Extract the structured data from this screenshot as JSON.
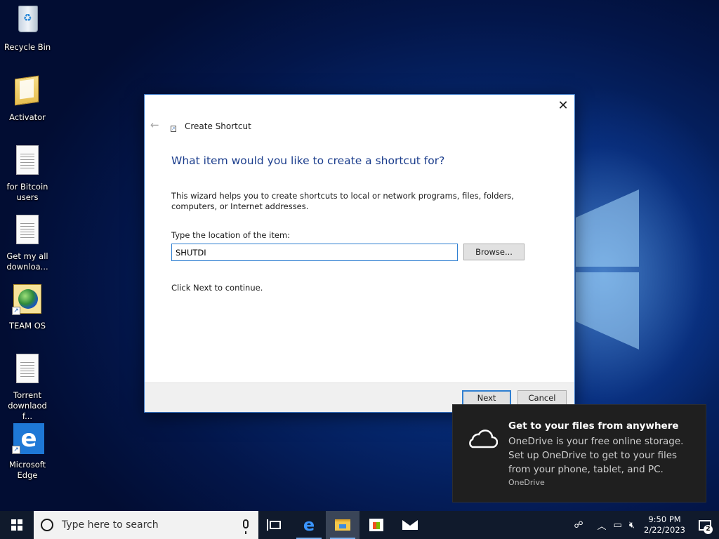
{
  "desktop": {
    "icons": [
      {
        "label": "Recycle Bin",
        "icon": "recycle-bin-icon"
      },
      {
        "label": "Activator",
        "icon": "folder-icon"
      },
      {
        "label": "for Bitcoin users",
        "icon": "text-document-icon"
      },
      {
        "label": "Get my all downloa...",
        "icon": "text-document-icon"
      },
      {
        "label": "TEAM OS",
        "icon": "globe-shortcut-icon"
      },
      {
        "label": "Torrent downlaod f...",
        "icon": "text-document-icon"
      },
      {
        "label": "Microsoft Edge",
        "icon": "edge-icon"
      }
    ]
  },
  "dialog": {
    "title": "Create Shortcut",
    "heading": "What item would you like to create a shortcut for?",
    "description": "This wizard helps you to create shortcuts to local or network programs, files, folders, computers, or Internet addresses.",
    "location_label": "Type the location of the item:",
    "location_value": "SHUTDI",
    "browse_label": "Browse...",
    "continue_text": "Click Next to continue.",
    "next_label": "Next",
    "cancel_label": "Cancel",
    "close_glyph": "✕",
    "back_glyph": "←"
  },
  "toast": {
    "title": "Get to your files from anywhere",
    "body": "OneDrive is your free online storage. Set up OneDrive to get to your files from your phone, tablet, and PC.",
    "source": "OneDrive",
    "icon": "cloud-icon"
  },
  "taskbar": {
    "search_placeholder": "Type here to search",
    "time": "9:50 PM",
    "date": "2/22/2023",
    "notification_count": "2",
    "accent": "#7ab0f0"
  }
}
